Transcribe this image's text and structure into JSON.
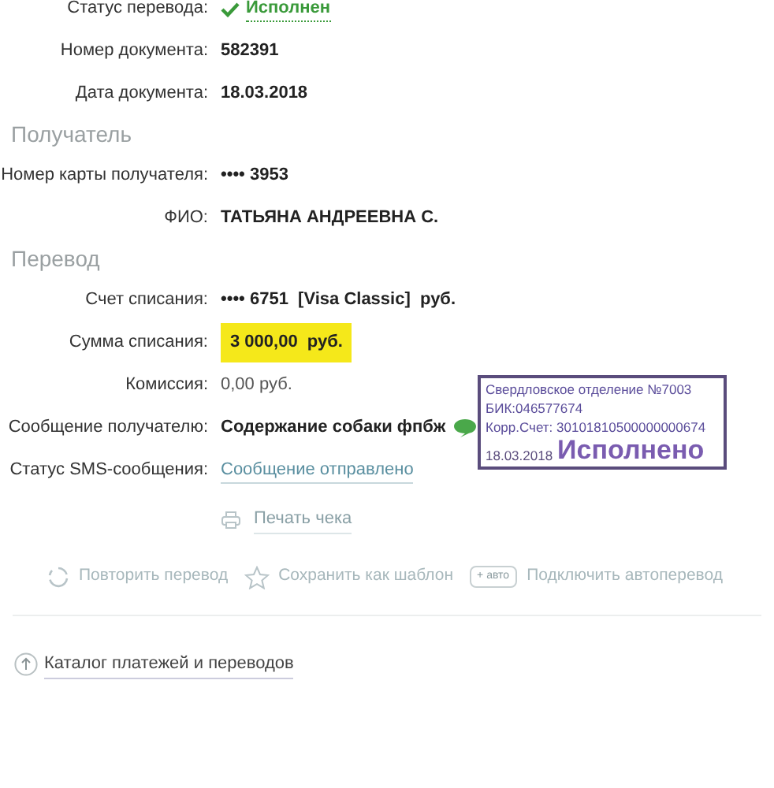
{
  "top_rows": [
    {
      "kind": "status",
      "label": "Статус перевода:",
      "value": "Исполнен"
    },
    {
      "kind": "bold",
      "label": "Номер документа:",
      "value": "582391"
    },
    {
      "kind": "bold",
      "label": "Дата документа:",
      "value": "18.03.2018"
    }
  ],
  "sections": [
    {
      "title": "Получатель",
      "rows": [
        {
          "kind": "bold",
          "label": "Номер карты получателя:",
          "value": "•••• 3953"
        },
        {
          "kind": "bold",
          "label": "ФИО:",
          "value": "ТАТЬЯНА АНДРЕЕВНА С."
        }
      ]
    },
    {
      "title": "Перевод",
      "rows": [
        {
          "kind": "bold",
          "label": "Счет списания:",
          "value": "•••• 6751  [Visa Classic]  руб."
        },
        {
          "kind": "highlight",
          "label": "Сумма списания:",
          "value": "3 000,00  руб."
        },
        {
          "kind": "plain",
          "label": "Комиссия:",
          "value": "0,00 руб."
        },
        {
          "kind": "message",
          "label": "Сообщение получателю:",
          "value": "Содержание собаки фпбж"
        },
        {
          "kind": "link",
          "label": "Статус SMS-сообщения:",
          "value": "Сообщение отправлено"
        }
      ]
    }
  ],
  "print_link": "Печать чека",
  "actions": [
    {
      "kind": "repeat",
      "label": "Повторить перевод"
    },
    {
      "kind": "template",
      "label": "Сохранить как шаблон"
    },
    {
      "kind": "auto",
      "badge": "+ авто",
      "label": "Подключить автоперевод"
    }
  ],
  "catalog_link": "Каталог платежей и переводов",
  "stamp": {
    "lines": [
      "Свердловское отделение №7003",
      "БИК:046577674",
      "Корр.Счет: 30101810500000000674"
    ],
    "status": "Исполнено",
    "date": "18.03.2018"
  }
}
